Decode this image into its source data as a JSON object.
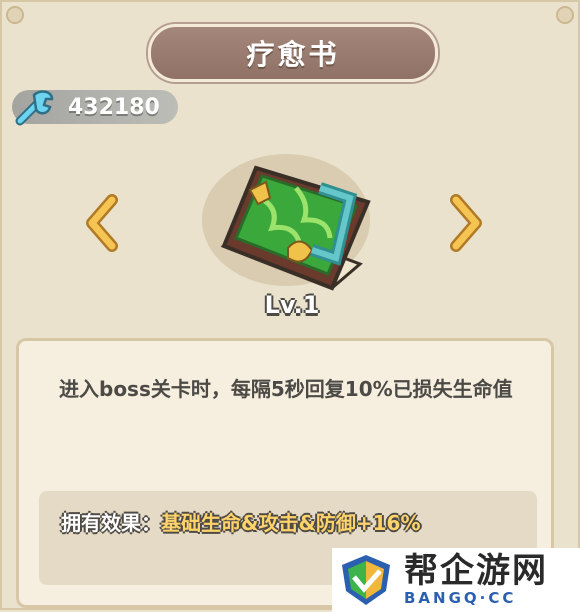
{
  "header": {
    "title": "疗愈书"
  },
  "currency": {
    "icon": "wrench-icon",
    "amount": "432180"
  },
  "item": {
    "level": "Lv.1",
    "icon": "green-book-icon"
  },
  "description": {
    "text": "进入boss关卡时，每隔5秒回复10%已损失生命值",
    "effect_label": "拥有效果：",
    "effect_value": "基础生命&攻击&防御+16%"
  },
  "watermark": {
    "main": "帮企游网",
    "sub": "BANGQ·CC"
  },
  "colors": {
    "title_plate": "#9b7e71",
    "panel": "#f6eede",
    "accent_gold": "#ffd36b",
    "arrow": "#f0b73c"
  }
}
